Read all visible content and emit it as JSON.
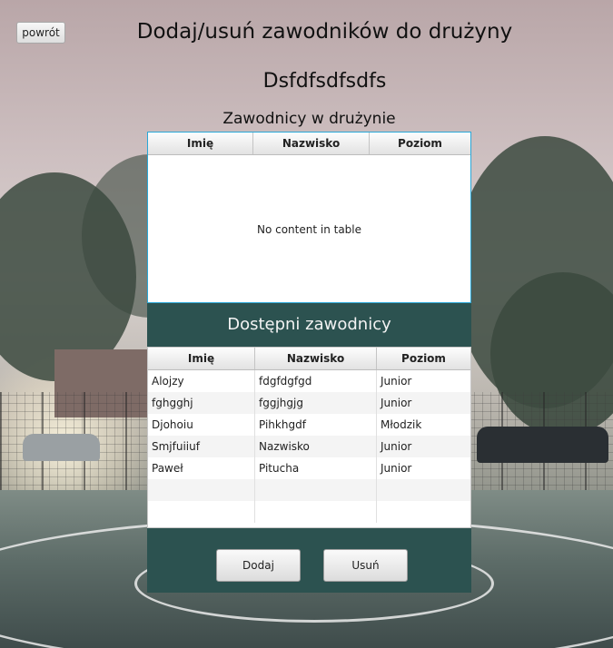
{
  "header": {
    "back_label": "powrót",
    "title": "Dodaj/usuń zawodników do drużyny",
    "team_name": "Dsfdfsdfsdfs"
  },
  "team_table": {
    "label": "Zawodnicy w drużynie",
    "columns": [
      "Imię",
      "Nazwisko",
      "Poziom"
    ],
    "empty_message": "No content in table",
    "rows": []
  },
  "available_table": {
    "label": "Dostępni zawodnicy",
    "columns": [
      "Imię",
      "Nazwisko",
      "Poziom"
    ],
    "rows": [
      [
        "Alojzy",
        "fdgfdgfgd",
        "Junior"
      ],
      [
        "fghgghj",
        "fggjhgjg",
        "Junior"
      ],
      [
        "Djohoiu",
        "Pihkhgdf",
        "Młodzik"
      ],
      [
        "Smjfuiiuf",
        "Nazwisko",
        "Junior"
      ],
      [
        "Paweł",
        "Pitucha",
        "Junior"
      ]
    ]
  },
  "actions": {
    "add_label": "Dodaj",
    "remove_label": "Usuń"
  },
  "colors": {
    "panel_dark": "#2c5250",
    "selection_border": "#2aa7d7"
  }
}
